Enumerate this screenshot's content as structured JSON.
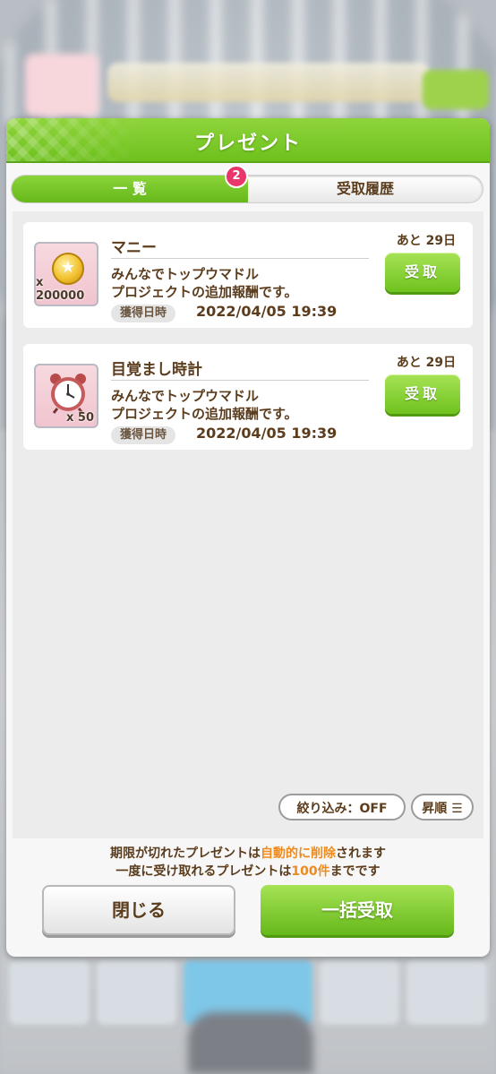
{
  "dialog": {
    "title": "プレゼント",
    "tabs": [
      {
        "label": "一 覧",
        "active": true,
        "badge": "2"
      },
      {
        "label": "受取履歴",
        "active": false
      }
    ]
  },
  "presents": [
    {
      "name": "マニー",
      "icon": "coin-icon",
      "quantity": "x 200000",
      "description": "みんなでトップウマドル\nプロジェクトの追加報酬です。",
      "date_label": "獲得日時",
      "date": "2022/04/05 19:39",
      "remaining": "あと 29日",
      "receive_label": "受取"
    },
    {
      "name": "目覚まし時計",
      "icon": "alarm-clock-icon",
      "quantity": "x 50",
      "description": "みんなでトップウマドル\nプロジェクトの追加報酬です。",
      "date_label": "獲得日時",
      "date": "2022/04/05 19:39",
      "remaining": "あと 29日",
      "receive_label": "受取"
    }
  ],
  "filter": {
    "filter_label": "絞り込み：OFF",
    "sort_label": "昇順 ☰"
  },
  "notes": {
    "line1_a": "期限が切れたプレゼントは",
    "line1_highlight": "自動的に削除",
    "line1_b": "されます",
    "line2_a": "一度に受け取れるプレゼントは",
    "line2_highlight": "100件",
    "line2_b": "までです"
  },
  "buttons": {
    "close": "閉じる",
    "receive_all": "一括受取"
  },
  "colors": {
    "accent_green": "#6ec11d",
    "text_brown": "#5b3c1c",
    "badge_pink": "#e8356a",
    "highlight_orange": "#ef8a1c"
  }
}
